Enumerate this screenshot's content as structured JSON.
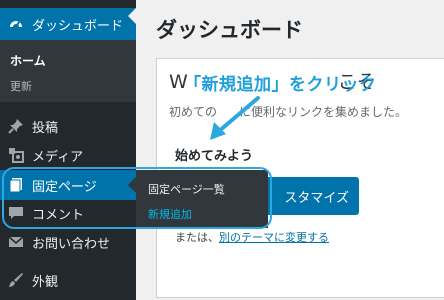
{
  "sidebar": {
    "dashboard_label": "ダッシュボード",
    "home_label": "ホーム",
    "updates_label": "更新",
    "items": [
      {
        "label": "投稿"
      },
      {
        "label": "メディア"
      },
      {
        "label": "固定ページ"
      },
      {
        "label": "コメント"
      },
      {
        "label": "お問い合わせ"
      },
      {
        "label": "外観"
      }
    ]
  },
  "flyout": {
    "all_pages": "固定ページ一覧",
    "add_new": "新規追加"
  },
  "main": {
    "title": "ダッシュボード",
    "welcome_partial": "W",
    "welcome_suffix": "こそ",
    "welcome_sub_left": "初めての",
    "welcome_sub_right": "に便利なリンクを集めました。",
    "get_started_left": "始めて",
    "get_started_right": "みよう",
    "customize_button": "スタマイズ",
    "or_prefix": "または、",
    "change_theme_link": "別のテーマに変更する"
  },
  "annotation": {
    "callout": "「新規追加」をクリック"
  },
  "colors": {
    "sidebar_bg": "#23282d",
    "submenu_bg": "#32373c",
    "accent": "#0073aa",
    "annotation": "#2ea6e0"
  }
}
